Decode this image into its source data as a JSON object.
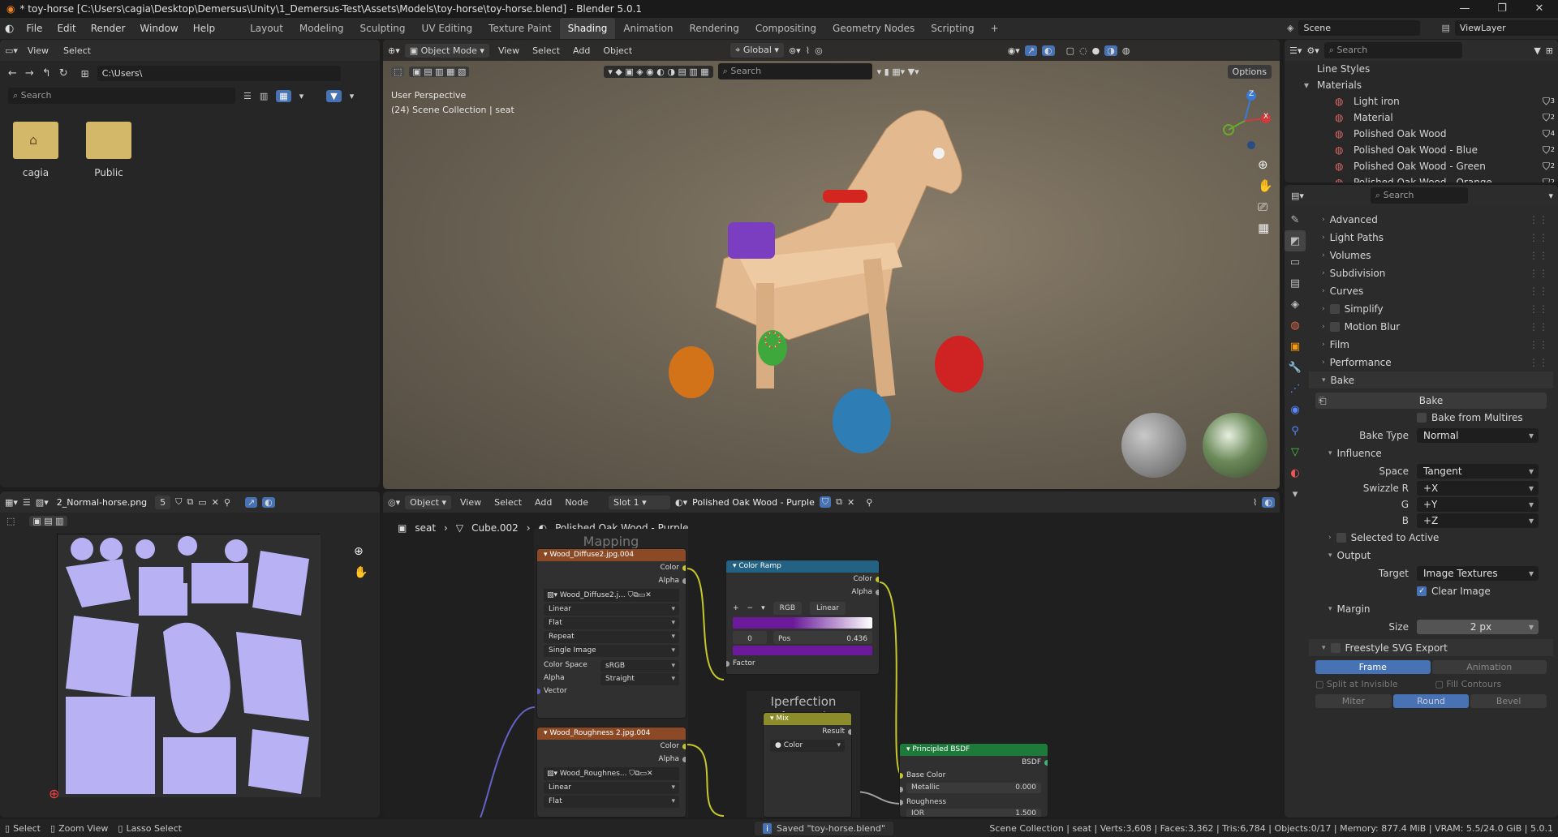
{
  "window": {
    "title": "* toy-horse [C:\\Users\\cagia\\Desktop\\Demersus\\Unity\\1_Demersus-Test\\Assets\\Models\\toy-horse\\toy-horse.blend] - Blender 5.0.1",
    "minimize": "—",
    "maximize": "❐",
    "close": "✕"
  },
  "menu": [
    "File",
    "Edit",
    "Render",
    "Window",
    "Help"
  ],
  "workspaces": [
    "Layout",
    "Modeling",
    "Sculpting",
    "UV Editing",
    "Texture Paint",
    "Shading",
    "Animation",
    "Rendering",
    "Compositing",
    "Geometry Nodes",
    "Scripting"
  ],
  "workspace_add": "+",
  "scene": {
    "name": "Scene",
    "viewlayer": "ViewLayer"
  },
  "filebrowser": {
    "menus": [
      "View",
      "Select"
    ],
    "path": "C:\\Users\\",
    "search_placeholder": "Search",
    "folders": [
      "cagia",
      "Public"
    ]
  },
  "viewport": {
    "mode": "Object Mode",
    "menus": [
      "View",
      "Select",
      "Add",
      "Object"
    ],
    "orientation": "Global",
    "options": "Options",
    "search_placeholder": "Search",
    "overlay_line1": "User Perspective",
    "overlay_line2": "(24) Scene Collection | seat",
    "axis": {
      "x": "X",
      "y": "Y",
      "z": "Z"
    }
  },
  "image_editor": {
    "image": "2_Normal-horse.png",
    "users": "5"
  },
  "node_editor": {
    "mode": "Object",
    "menus": [
      "View",
      "Select",
      "Add",
      "Node"
    ],
    "slot": "Slot 1",
    "material": "Polished Oak Wood - Purple",
    "breadcrumb": [
      "seat",
      "Cube.002",
      "Polished Oak Wood - Purple"
    ],
    "frame_label": "Mapping",
    "frame_label2": "Iperfection Amount"
  },
  "nodes": {
    "diffuse": {
      "title": "Wood_Diffuse2.jpg.004",
      "out1": "Color",
      "out2": "Alpha",
      "img": "Wood_Diffuse2.j...",
      "interp": "Linear",
      "proj": "Flat",
      "ext": "Repeat",
      "src": "Single Image",
      "cs_label": "Color Space",
      "cs": "sRGB",
      "alpha_label": "Alpha",
      "alpha": "Straight",
      "vector": "Vector"
    },
    "rough": {
      "title": "Wood_Roughness 2.jpg.004",
      "out1": "Color",
      "out2": "Alpha",
      "img": "Wood_Roughnes...",
      "interp": "Linear",
      "proj": "Flat"
    },
    "ramp": {
      "title": "Color Ramp",
      "out1": "Color",
      "out2": "Alpha",
      "mode": "RGB",
      "interp": "Linear",
      "index": "0",
      "pos_label": "Pos",
      "pos": "0.436",
      "factor": "Factor"
    },
    "mix": {
      "title": "Mix",
      "result": "Result",
      "color": "Color"
    },
    "bsdf": {
      "title": "Principled BSDF",
      "out": "BSDF",
      "base": "Base Color",
      "metallic": "Metallic",
      "metallic_val": "0.000",
      "roughness": "Roughness",
      "ior": "IOR",
      "ior_val": "1.500"
    }
  },
  "outliner": {
    "search_placeholder": "Search",
    "items": [
      {
        "label": "Line Styles",
        "indent": 0
      },
      {
        "label": "Materials",
        "indent": 0
      },
      {
        "label": "Light iron",
        "indent": 1,
        "badge": "3"
      },
      {
        "label": "Material",
        "indent": 1,
        "badge": "2"
      },
      {
        "label": "Polished Oak Wood",
        "indent": 1,
        "badge": "4"
      },
      {
        "label": "Polished Oak Wood - Blue",
        "indent": 1,
        "badge": "2"
      },
      {
        "label": "Polished Oak Wood - Green",
        "indent": 1,
        "badge": "2"
      },
      {
        "label": "Polished Oak Wood - Orange",
        "indent": 1,
        "badge": "2"
      }
    ]
  },
  "properties": {
    "search_placeholder": "Search",
    "panels": [
      "Advanced",
      "Light Paths",
      "Volumes",
      "Subdivision",
      "Curves",
      "Simplify",
      "Motion Blur",
      "Film",
      "Performance"
    ],
    "bake": {
      "title": "Bake",
      "button": "Bake",
      "multires": "Bake from Multires",
      "type_label": "Bake Type",
      "type": "Normal",
      "influence": "Influence",
      "space_label": "Space",
      "space": "Tangent",
      "swr_label": "Swizzle R",
      "swr": "+X",
      "swg_label": "G",
      "swg": "+Y",
      "swb_label": "B",
      "swb": "+Z",
      "selected": "Selected to Active",
      "output": "Output",
      "target_label": "Target",
      "target": "Image Textures",
      "clear": "Clear Image",
      "margin": "Margin",
      "size_label": "Size",
      "size": "2 px"
    },
    "freestyle": {
      "title": "Freestyle SVG Export",
      "frame": "Frame",
      "animation": "Animation",
      "split": "Split at Invisible",
      "fill": "Fill Contours",
      "miter": "Miter",
      "round": "Round",
      "bevel": "Bevel"
    }
  },
  "status": {
    "select": "Select",
    "zoom": "Zoom View",
    "lasso": "Lasso Select",
    "saved": "Saved \"toy-horse.blend\"",
    "stats": "Scene Collection | seat | Verts:3,608 | Faces:3,362 | Tris:6,784 | Objects:0/17 | Memory: 877.4 MiB | VRAM: 5.5/24.0 GiB | 5.0.1"
  }
}
